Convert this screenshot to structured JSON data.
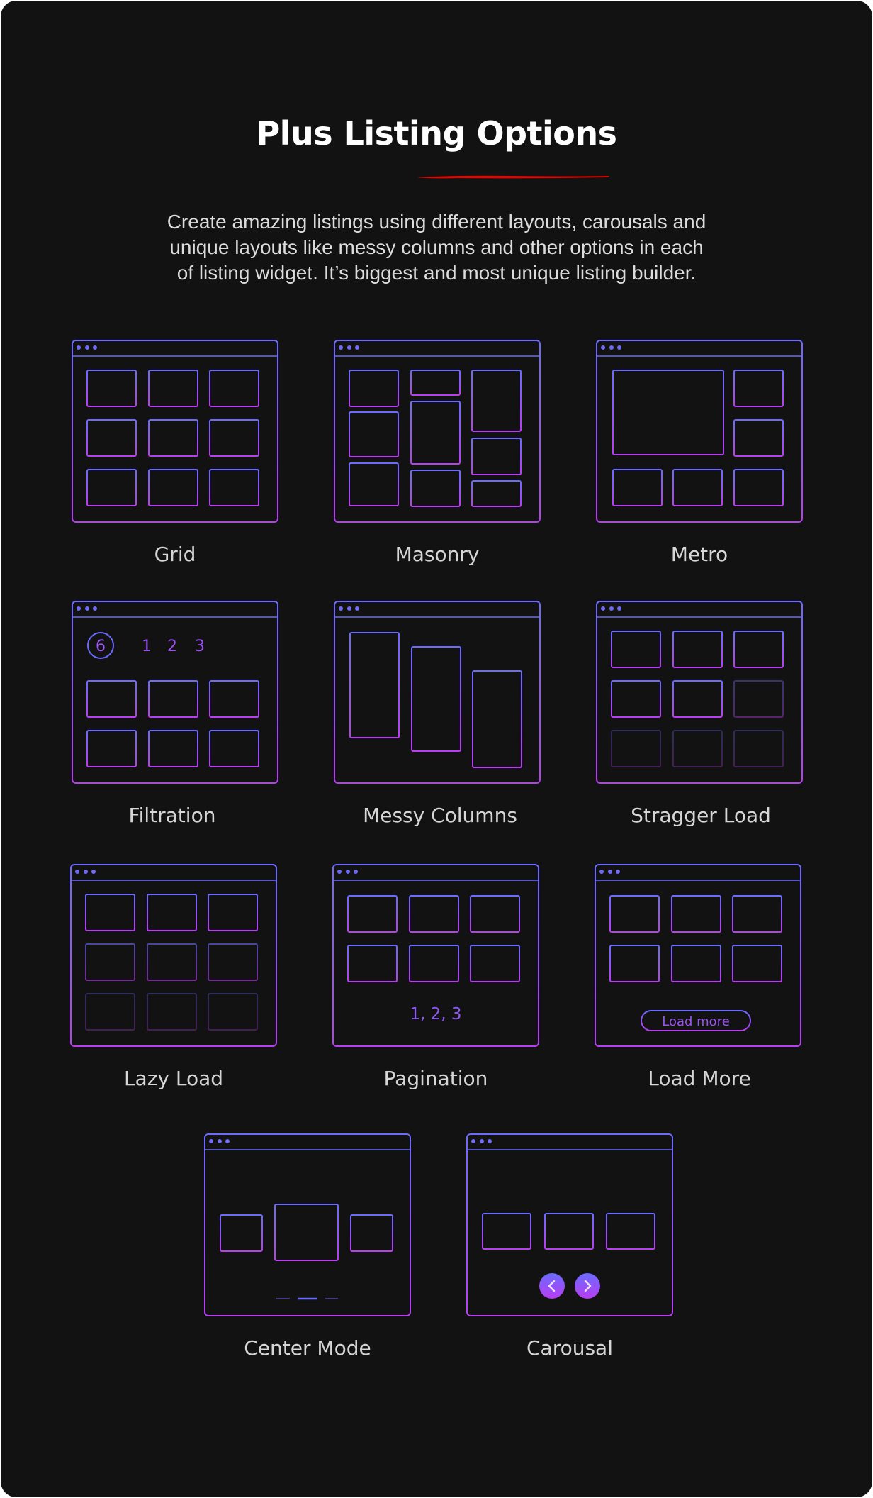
{
  "colors": {
    "background": "#121212",
    "title": "#ffffff",
    "description": "#dcdcdc",
    "label": "#d6d6d6",
    "underline": "#e10600",
    "gradient_top": "#6b6bff",
    "gradient_bottom": "#b83ef2",
    "window_dots": "#6f6cf6"
  },
  "header": {
    "title": "Plus Listing Options",
    "description_lines": [
      "Create amazing listings using different layouts, carousals and",
      "unique layouts like messy columns and other options in each",
      "of listing widget. It’s biggest and most unique listing builder."
    ]
  },
  "options": [
    {
      "id": "grid",
      "label": "Grid",
      "icon": "grid-layout-icon"
    },
    {
      "id": "masonry",
      "label": "Masonry",
      "icon": "masonry-layout-icon"
    },
    {
      "id": "metro",
      "label": "Metro",
      "icon": "metro-layout-icon"
    },
    {
      "id": "filtration",
      "label": "Filtration",
      "icon": "filtration-layout-icon",
      "filter_count": "6",
      "filter_tabs": [
        "1",
        "2",
        "3"
      ]
    },
    {
      "id": "messy",
      "label": "Messy Columns",
      "icon": "messy-columns-layout-icon"
    },
    {
      "id": "stagger",
      "label": "Stragger Load",
      "icon": "stagger-load-layout-icon",
      "item_visibility": [
        1,
        1,
        1,
        1,
        1,
        0.4,
        0.3,
        0.3,
        0.3
      ]
    },
    {
      "id": "lazy",
      "label": "Lazy Load",
      "icon": "lazy-load-layout-icon",
      "item_visibility": [
        1,
        1,
        1,
        0.6,
        0.6,
        0.6,
        0.3,
        0.3,
        0.3
      ]
    },
    {
      "id": "pagination",
      "label": "Pagination",
      "icon": "pagination-layout-icon",
      "pages_text": "1, 2, 3"
    },
    {
      "id": "loadmore",
      "label": "Load More",
      "icon": "load-more-layout-icon",
      "button_label": "Load more"
    },
    {
      "id": "center",
      "label": "Center Mode",
      "icon": "center-mode-layout-icon",
      "active_slide": 2,
      "slide_count": 3
    },
    {
      "id": "carousal",
      "label": "Carousal",
      "icon": "carousal-layout-icon",
      "prev_icon": "chevron-left-icon",
      "next_icon": "chevron-right-icon"
    }
  ]
}
